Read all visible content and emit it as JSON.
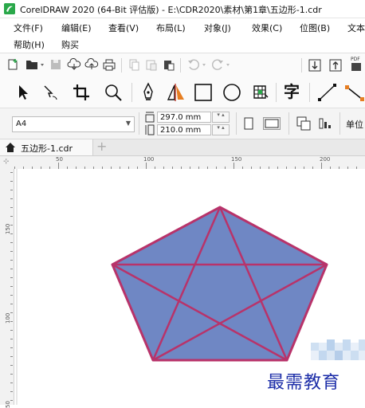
{
  "window": {
    "title": "CorelDRAW 2020 (64-Bit 评估版) - E:\\CDR2020\\素材\\第1章\\五边形-1.cdr"
  },
  "menus": {
    "row1": [
      "文件(F)",
      "编辑(E)",
      "查看(V)",
      "布局(L)",
      "对象(J)",
      "效果(C)",
      "位图(B)",
      "文本"
    ],
    "row2": [
      "帮助(H)",
      "购买"
    ]
  },
  "standard_toolbar": {
    "icons": [
      "new-document-icon",
      "open-icon",
      "save-icon",
      "cloud-import-icon",
      "cloud-export-icon",
      "print-icon",
      "copy-icon",
      "paste-icon",
      "clipboard-icon",
      "undo-icon",
      "redo-icon",
      "import-icon",
      "export-icon",
      "pdf-icon"
    ],
    "pdf_label": "PDF"
  },
  "toolbox": {
    "icons": [
      "pick-tool-icon",
      "shape-tool-icon",
      "crop-tool-icon",
      "zoom-tool-icon",
      "pen-tool-icon",
      "artistic-media-icon",
      "rectangle-tool-icon",
      "ellipse-tool-icon",
      "graph-paper-icon",
      "text-tool-icon",
      "line-tool-icon",
      "connector-tool-icon"
    ],
    "text_tool_label": "字"
  },
  "property_bar": {
    "page_size": "A4",
    "width": "297.0 mm",
    "height": "210.0 mm",
    "units_label": "单位"
  },
  "document_tab": {
    "name": "五边形-1.cdr",
    "add_label": "+"
  },
  "rulers": {
    "horizontal_labels": [
      "50",
      "100",
      "150",
      "200"
    ],
    "vertical_labels": [
      "150",
      "100",
      "50"
    ]
  },
  "shape": {
    "type": "pentagon-with-pentagram",
    "fill": "#6f87c4",
    "stroke": "#b8336a"
  },
  "watermark": {
    "text": "最需教育"
  }
}
